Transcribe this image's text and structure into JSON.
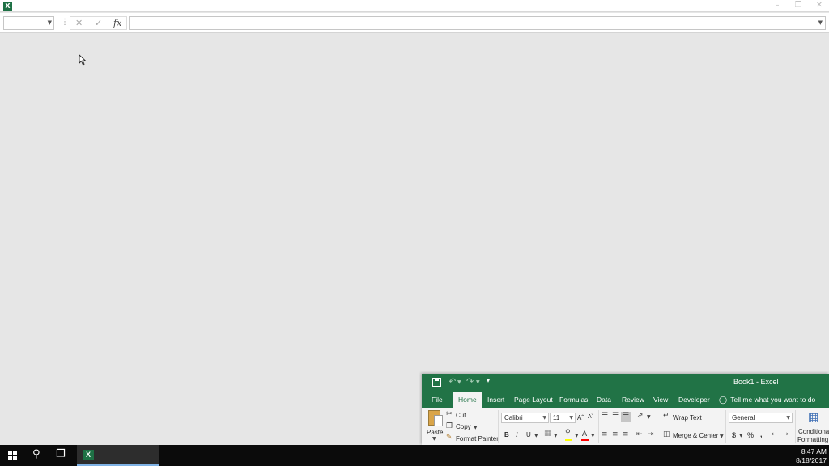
{
  "back_window": {
    "app_icon": "excel-icon",
    "controls": [
      "minimize-icon",
      "restore-icon",
      "close-icon"
    ],
    "formula_bar": {
      "name_box_value": "",
      "cancel_icon": "x-icon",
      "enter_icon": "check-icon",
      "fx_label": "fx",
      "formula_value": ""
    }
  },
  "front_window": {
    "title": "Book1  -  Excel",
    "brand_color": "#217346",
    "tabs": [
      {
        "label": "File"
      },
      {
        "label": "Home",
        "active": true
      },
      {
        "label": "Insert"
      },
      {
        "label": "Page Layout"
      },
      {
        "label": "Formulas"
      },
      {
        "label": "Data"
      },
      {
        "label": "Review"
      },
      {
        "label": "View"
      },
      {
        "label": "Developer"
      }
    ],
    "tell_me": "Tell me what you want to do",
    "ribbon": {
      "paste_label": "Paste",
      "cut_label": "Cut",
      "copy_label": "Copy",
      "format_painter_label": "Format Painter",
      "font_name": "Calibri",
      "font_size": "11",
      "bold": "B",
      "italic": "I",
      "underline": "U",
      "font_color_letter": "A",
      "fill_color": "#ffff00",
      "font_color": "#ff0000",
      "wrap_text_label": "Wrap Text",
      "merge_center_label": "Merge & Center",
      "number_format": "General",
      "currency_symbol": "$",
      "percent_symbol": "%",
      "comma_symbol": ",",
      "conditional_formatting_line1": "Conditional",
      "conditional_formatting_line2": "Formatting"
    }
  },
  "taskbar": {
    "time": "8:47 AM",
    "date": "8/18/2017"
  }
}
